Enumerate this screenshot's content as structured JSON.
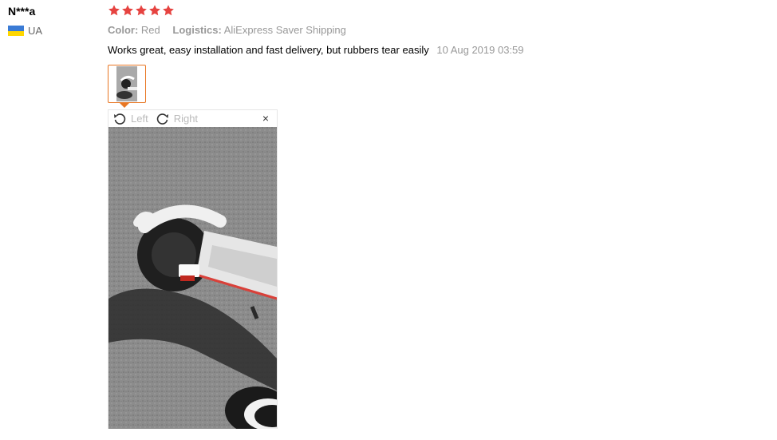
{
  "reviewer": {
    "name": "N***a",
    "country": "UA",
    "flag_colors": {
      "top": "#3a7bd5",
      "bottom": "#ffd700"
    }
  },
  "rating": {
    "stars": 5,
    "max": 5,
    "star_color": "#e64340"
  },
  "attributes": {
    "color_label": "Color:",
    "color_value": "Red",
    "logistics_label": "Logistics:",
    "logistics_value": "AliExpress Saver Shipping"
  },
  "review": {
    "text": "Works great, easy installation and fast delivery, but rubbers tear easily",
    "date": "10 Aug 2019 03:59"
  },
  "viewer": {
    "rotate_left_label": "Left",
    "rotate_right_label": "Right",
    "close_glyph": "×",
    "accent_color": "#e87724"
  }
}
